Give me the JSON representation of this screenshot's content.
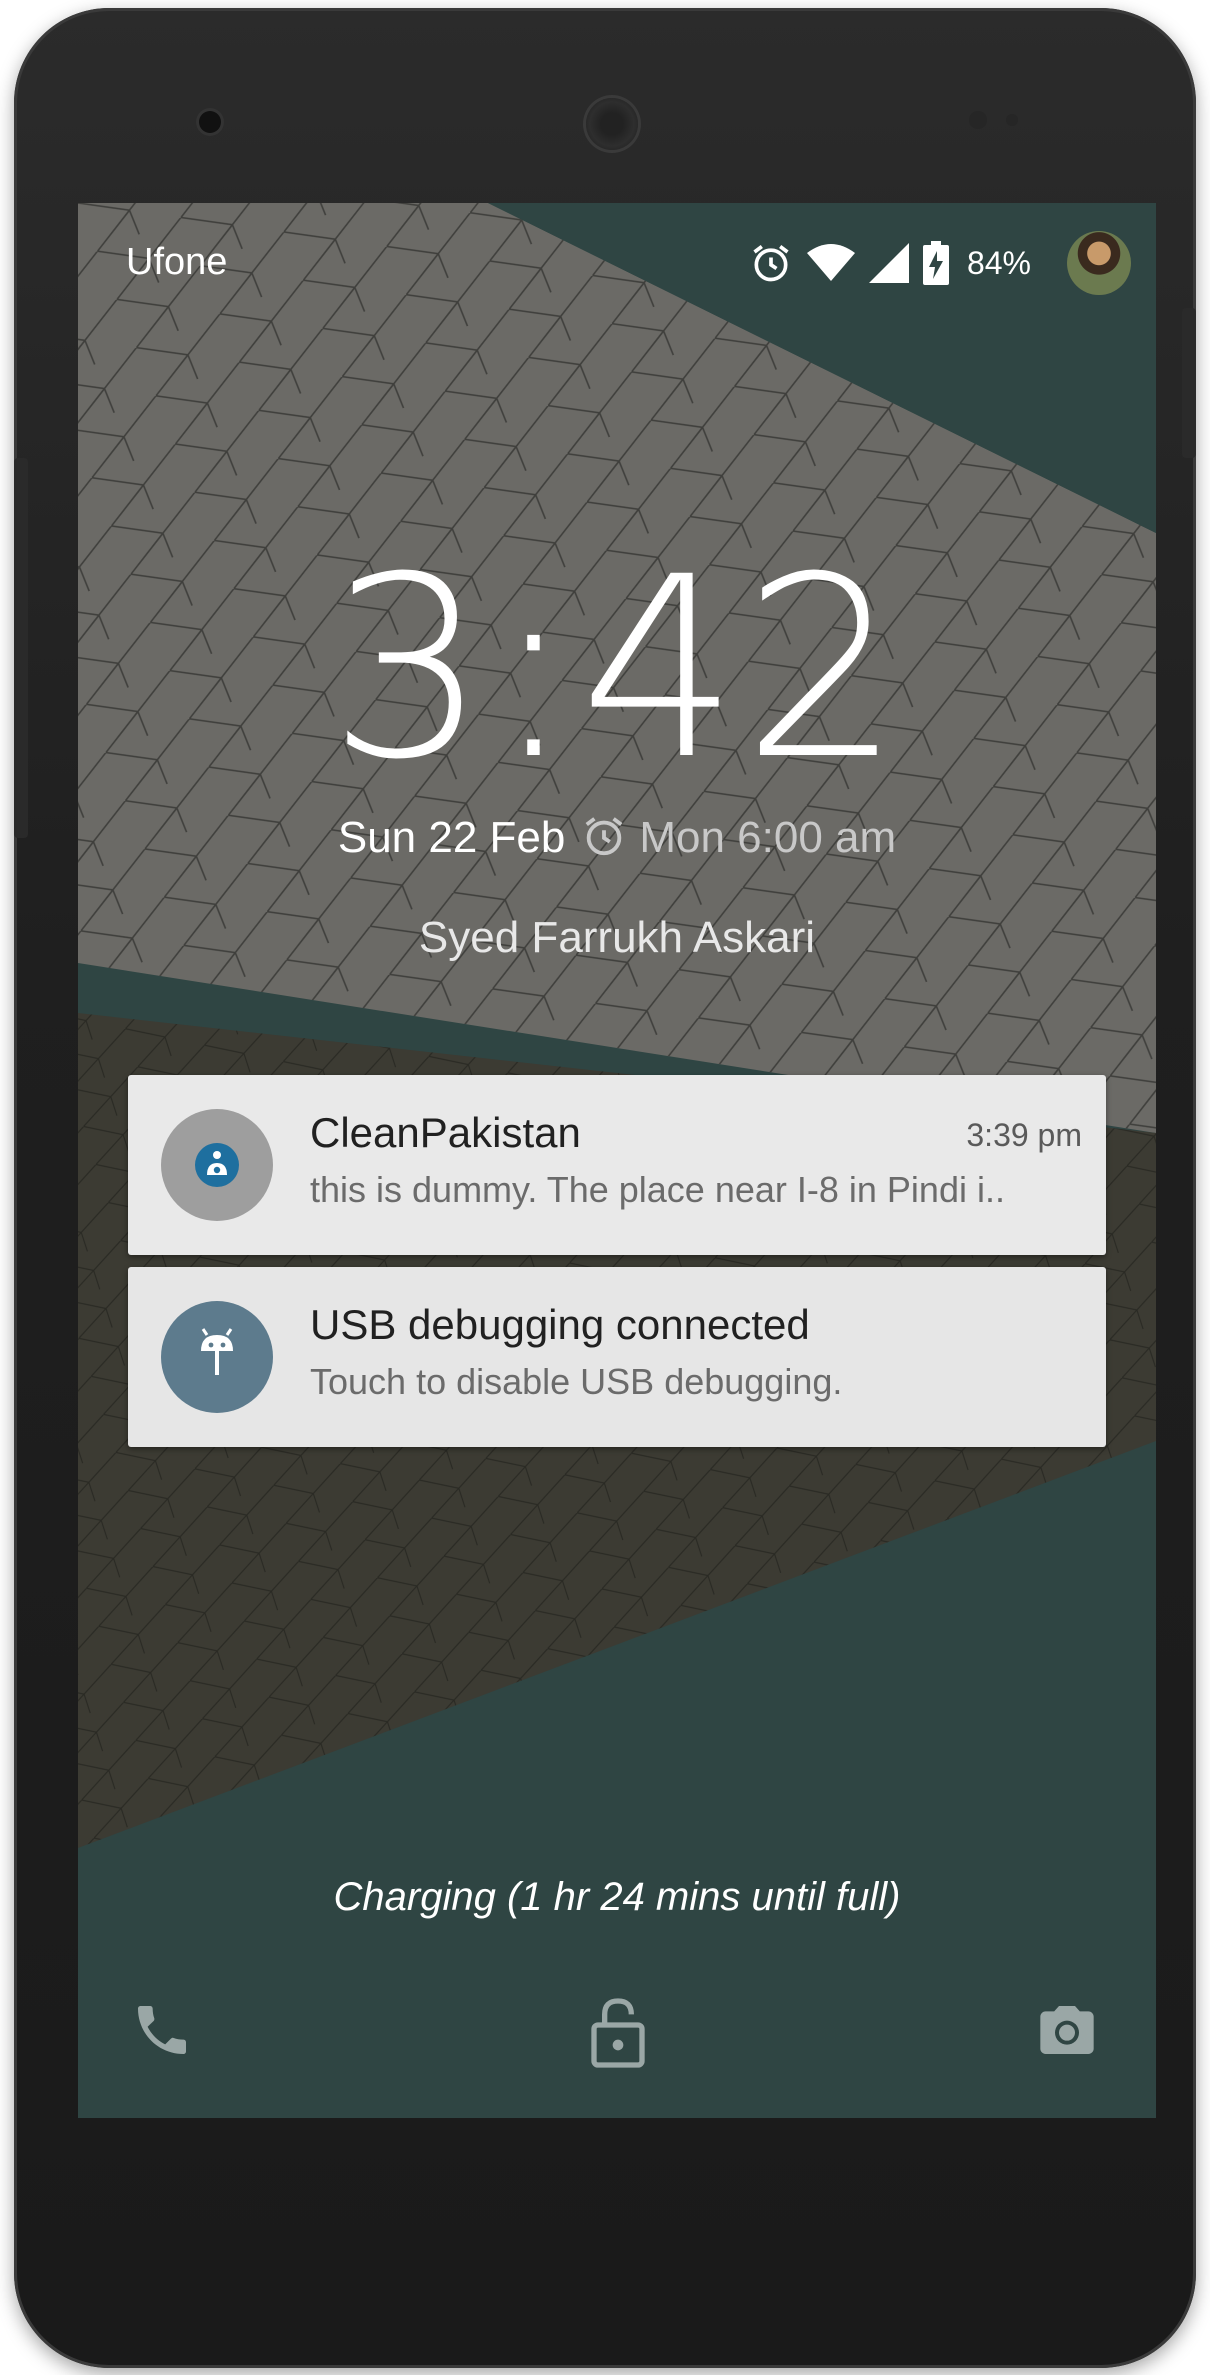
{
  "status_bar": {
    "carrier": "Ufone",
    "battery_percent": "84%",
    "icons": [
      "alarm-icon",
      "wifi-icon",
      "signal-icon",
      "battery-charging-icon",
      "user-avatar"
    ]
  },
  "lockscreen": {
    "clock": "3:42",
    "date": "Sun 22 Feb",
    "next_alarm": "Mon 6:00 am",
    "owner_info": "Syed Farrukh Askari",
    "charging_text": "Charging (1 hr 24 mins until full)"
  },
  "notifications": [
    {
      "app": "CleanPakistan",
      "time": "3:39 pm",
      "text": "this is dummy. The place near I-8 in Pindi i..",
      "icon": "person-info-icon",
      "icon_bg": "#9e9e9e"
    },
    {
      "app": "USB debugging connected",
      "time": "",
      "text": "Touch to disable USB debugging.",
      "icon": "android-icon",
      "icon_bg": "#5d7b8d"
    }
  ],
  "shortcuts": [
    "phone-icon",
    "unlock-icon",
    "camera-icon"
  ],
  "colors": {
    "wallpaper_teal": "#2f4543",
    "wallpaper_gray": "#6a6a66",
    "notification_bg": "#e9e9e9"
  }
}
